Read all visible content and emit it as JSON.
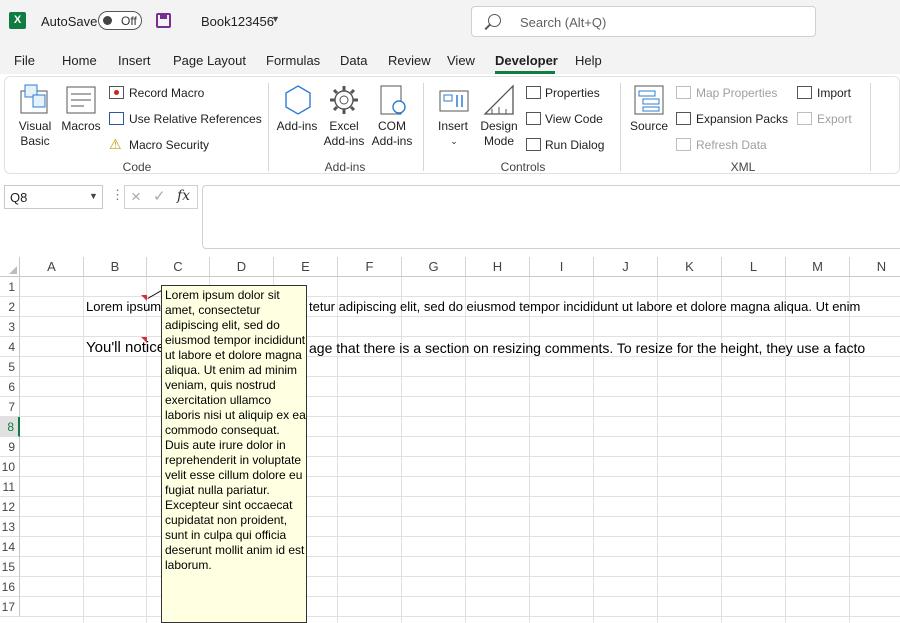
{
  "titlebar": {
    "app_logo_letter": "X",
    "autosave_label": "AutoSave",
    "autosave_state": "Off",
    "workbook_name": "Book123456",
    "search_placeholder": "Search (Alt+Q)"
  },
  "menu": {
    "tabs": [
      "File",
      "Home",
      "Insert",
      "Page Layout",
      "Formulas",
      "Data",
      "Review",
      "View",
      "Developer",
      "Help"
    ],
    "active_tab": "Developer",
    "accent_color": "#107c41"
  },
  "ribbon": {
    "code": {
      "label": "Code",
      "visual_basic": "Visual Basic",
      "macros": "Macros",
      "record_macro": "Record Macro",
      "use_relative": "Use Relative References",
      "macro_security": "Macro Security"
    },
    "addins": {
      "label": "Add-ins",
      "addins": "Add-ins",
      "excel_addins": "Excel Add-ins",
      "com_addins": "COM Add-ins"
    },
    "controls": {
      "label": "Controls",
      "insert": "Insert",
      "design_mode": "Design Mode",
      "properties": "Properties",
      "view_code": "View Code",
      "run_dialog": "Run Dialog"
    },
    "xml": {
      "label": "XML",
      "source": "Source",
      "map_properties": "Map Properties",
      "expansion_packs": "Expansion Packs",
      "refresh_data": "Refresh Data",
      "import": "Import",
      "export": "Export"
    }
  },
  "formula_bar": {
    "name_box": "Q8",
    "fx": "fx",
    "formula": ""
  },
  "grid": {
    "columns": [
      "A",
      "B",
      "C",
      "D",
      "E",
      "F",
      "G",
      "H",
      "I",
      "J",
      "K",
      "L",
      "M",
      "N"
    ],
    "rows": [
      "1",
      "2",
      "3",
      "4",
      "5",
      "6",
      "7",
      "8",
      "9",
      "10",
      "11",
      "12",
      "13",
      "14",
      "15",
      "16",
      "17"
    ],
    "selected_row": "8",
    "b2_left": "Lorem ipsum",
    "b2_right": "tetur adipiscing elit, sed do eiusmod tempor incididunt ut labore et dolore magna aliqua. Ut enim",
    "b4_left": "You'll notice",
    "b4_right": "age that there is a section on resizing comments.  To resize for the height, they use a facto"
  },
  "comment": {
    "text": "Lorem ipsum dolor sit amet, consectetur adipiscing elit, sed do eiusmod tempor incididunt ut labore et dolore magna aliqua. Ut enim ad minim veniam, quis nostrud exercitation ullamco laboris nisi ut aliquip ex ea commodo consequat. Duis aute irure dolor in reprehenderit in voluptate velit esse cillum dolore eu fugiat nulla pariatur. Excepteur sint occaecat cupidatat non proident, sunt in culpa qui officia deserunt mollit anim id est laborum.",
    "background": "#ffffe1",
    "indicator_color": "#d13438"
  }
}
